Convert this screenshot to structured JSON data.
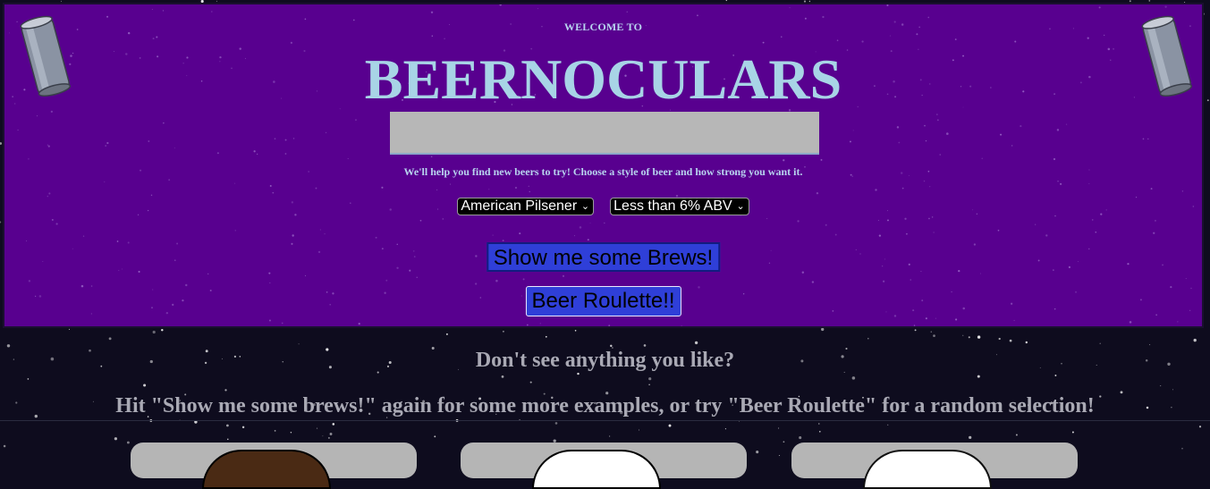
{
  "header": {
    "welcome": "WELCOME TO",
    "title": "BEERNOCULARS",
    "help_text": "We'll help you find new beers to try! Choose a style of beer and how strong you want it."
  },
  "filters": {
    "style": {
      "selected": "American Pilsener"
    },
    "strength": {
      "selected": "Less than 6% ABV"
    }
  },
  "buttons": {
    "show": "Show me some Brews!",
    "roulette": "Beer Roulette!!"
  },
  "notice": {
    "line1": "Don't see anything you like?",
    "line2": "Hit \"Show me some brews!\" again for some more examples, or try \"Beer Roulette\" for a random selection!"
  },
  "icons": {
    "decoration": "beer-can-icon",
    "dropdown": "chevron-down-icon"
  },
  "colors": {
    "header_bg": "#58008f",
    "title": "#a8d4e6",
    "button": "#2f3fd8",
    "page_bg": "#0e0c1e"
  }
}
